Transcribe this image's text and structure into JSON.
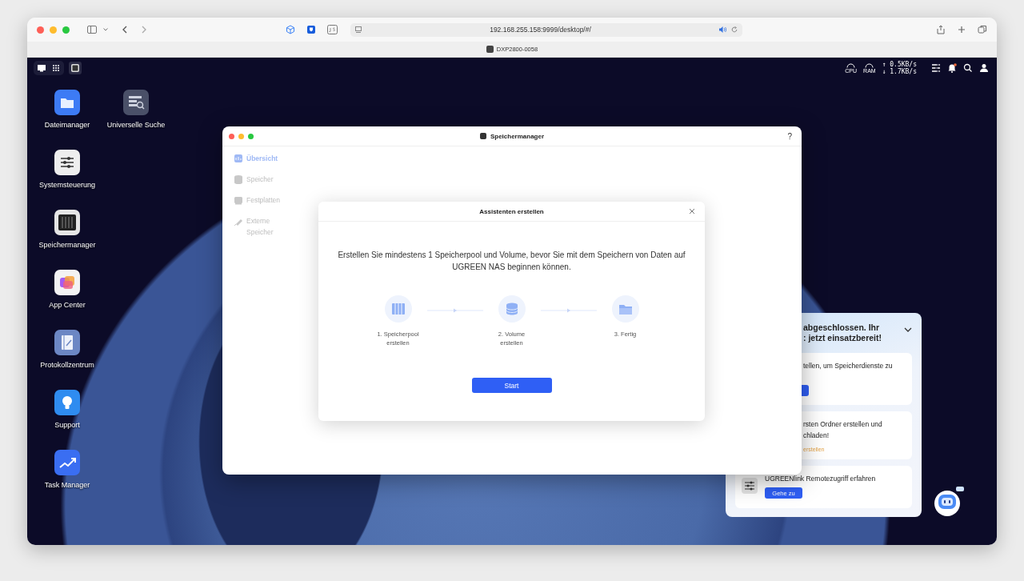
{
  "browser": {
    "url": "192.168.255.158:9999/desktop/#/",
    "tab_title": "DXP2800-0058"
  },
  "status_bar": {
    "cpu_label": "CPU",
    "ram_label": "RAM",
    "upload": "↑ 0.5KB/s",
    "download": "↓ 1.7KB/s"
  },
  "desktop_icons": [
    {
      "label": "Dateimanager",
      "kind": "folder"
    },
    {
      "label": "Universelle Suche",
      "kind": "search"
    },
    {
      "label": "Systemsteuerung",
      "kind": "sliders"
    },
    {
      "label": "Speichermanager",
      "kind": "storage"
    },
    {
      "label": "App Center",
      "kind": "apps"
    },
    {
      "label": "Protokollzentrum",
      "kind": "log"
    },
    {
      "label": "Support",
      "kind": "bulb"
    },
    {
      "label": "Task Manager",
      "kind": "chart"
    }
  ],
  "window": {
    "title": "Speichermanager",
    "help": "?",
    "sidebar": [
      {
        "label": "Übersicht",
        "kind": "overview",
        "selected": true
      },
      {
        "label": "Speicher",
        "kind": "storage",
        "selected": false
      },
      {
        "label": "Festplatten",
        "kind": "disk",
        "selected": false
      },
      {
        "label": "Externe Speicher",
        "kind": "external",
        "selected": false
      }
    ]
  },
  "dialog": {
    "title": "Assistenten erstellen",
    "message": "Erstellen Sie mindestens 1 Speicherpool und Volume, bevor Sie mit dem Speichern von Daten auf UGREEN NAS beginnen können.",
    "steps": [
      {
        "label": "1. Speicherpool erstellen",
        "kind": "pool"
      },
      {
        "label": "2. Volume erstellen",
        "kind": "volume"
      },
      {
        "label": "3. Fertig",
        "kind": "done"
      }
    ],
    "button": "Start"
  },
  "guide_panel": {
    "title_lines": [
      "abgeschlossen. Ihr",
      ": jetzt einsatzbereit!"
    ],
    "cards": [
      {
        "lines": [
          "tellen, um Speicherdienste zu"
        ],
        "kind": "button-partial"
      },
      {
        "lines": [
          "rsten Ordner erstellen und",
          "chladen!"
        ],
        "link": "erstellen",
        "kind": "link"
      },
      {
        "lines": [
          "UGREENlink Remotezugriff erfahren"
        ],
        "button": "Gehe zu",
        "kind": "button"
      }
    ]
  }
}
